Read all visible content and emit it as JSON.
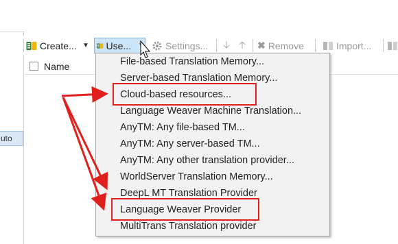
{
  "toolbar": {
    "create_label": "Create...",
    "use_label": "Use...",
    "settings_label": "Settings...",
    "remove_label": "Remove",
    "import_label": "Import..."
  },
  "grid": {
    "name_header": "Name"
  },
  "left_panel": {
    "chip_text": "uto"
  },
  "menu": {
    "items": [
      "File-based Translation Memory...",
      "Server-based Translation Memory...",
      "Cloud-based resources...",
      "Language Weaver Machine Translation...",
      "AnyTM: Any file-based TM...",
      "AnyTM: Any server-based TM...",
      "AnyTM: Any other translation provider...",
      "WorldServer Translation Memory...",
      "DeepL MT Translation Provider",
      "Language Weaver Provider",
      "MultiTrans Translation provider"
    ],
    "highlighted": [
      "Cloud-based resources...",
      "Language Weaver Provider"
    ]
  },
  "colors": {
    "annotation": "#e0201c",
    "active_button": "#cce4f7",
    "menu_bg": "#f2f2f2"
  }
}
